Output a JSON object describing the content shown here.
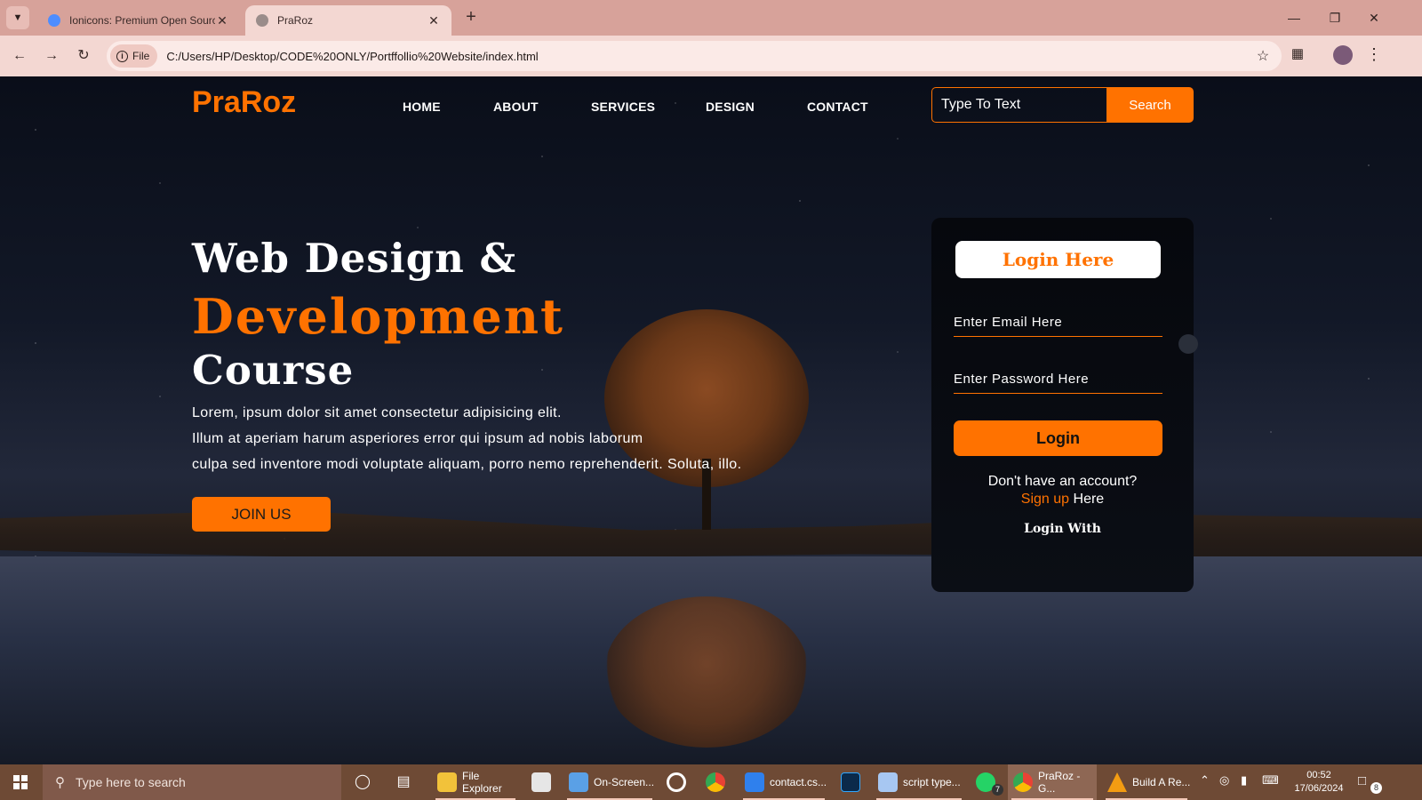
{
  "browser": {
    "tabs": [
      {
        "title": "Ionicons: Premium Open Source Icon Pack for Ionic Framework",
        "active": false
      },
      {
        "title": "PraRoz",
        "active": true
      }
    ],
    "address_chip": "File",
    "url": "C:/Users/HP/Desktop/CODE%20ONLY/Portffollio%20Website/index.html"
  },
  "site": {
    "logo": "PraRoz",
    "nav": [
      "HOME",
      "ABOUT",
      "SERVICES",
      "DESIGN",
      "CONTACT"
    ],
    "search_placeholder": "Type To Text",
    "search_button": "Search",
    "hero": {
      "line1": "Web Design &",
      "line2": "Development",
      "line3": "Course",
      "paragraph": [
        "Lorem, ipsum dolor sit amet consectetur adipisicing elit.",
        "Illum at aperiam harum asperiores error qui ipsum ad nobis laborum",
        "culpa sed inventore modi voluptate aliquam, porro nemo reprehenderit. Soluta, illo."
      ],
      "cta": "JOIN US"
    },
    "login": {
      "title": "Login Here",
      "email_placeholder": "Enter Email Here",
      "password_placeholder": "Enter Password Here",
      "button": "Login",
      "no_account": "Don't have an account?",
      "signup_link": "Sign up",
      "signup_suffix": "Here",
      "login_with": "Login With"
    },
    "colors": {
      "accent": "#ff7200",
      "text": "#ffffff"
    }
  },
  "taskbar": {
    "search_placeholder": "Type here to search",
    "apps": [
      {
        "label": "File Explorer",
        "color": "#f2c23a"
      },
      {
        "label": "",
        "color": "#e6e6e6"
      },
      {
        "label": "On-Screen...",
        "color": "#5aa0e6"
      },
      {
        "label": "",
        "color": "#ffffff"
      },
      {
        "label": "",
        "color": "#e94235"
      },
      {
        "label": "contact.cs...",
        "color": "#2f80ed"
      },
      {
        "label": "",
        "color": "#0b2a4a"
      },
      {
        "label": "script type...",
        "color": "#a7c7f2"
      },
      {
        "label": "",
        "color": "#25d366"
      },
      {
        "label": "PraRoz - G...",
        "color": "#e94235"
      },
      {
        "label": "Build A Re...",
        "color": "#f39c12"
      }
    ],
    "whatsapp_badge": "7",
    "notification_count": "8",
    "time": "00:52",
    "date": "17/06/2024"
  }
}
